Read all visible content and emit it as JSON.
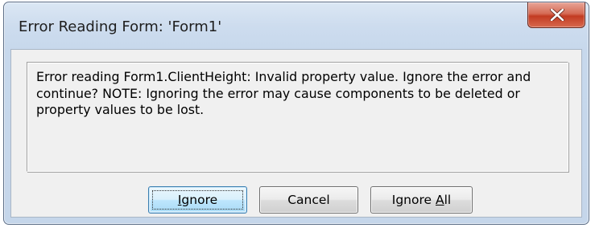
{
  "window": {
    "title": "Error Reading Form: 'Form1'"
  },
  "message": {
    "text": "Error reading Form1.ClientHeight: Invalid property value.  Ignore the error and\ncontinue?  NOTE: Ignoring the error may cause components to be deleted or\nproperty values to be lost."
  },
  "buttons": {
    "ignore": {
      "accel": "I",
      "rest": "gnore"
    },
    "cancel": {
      "label": "Cancel"
    },
    "ignore_all": {
      "before": "Ignore ",
      "accel": "A",
      "rest": "ll"
    }
  },
  "icons": {
    "close": "close-icon"
  }
}
